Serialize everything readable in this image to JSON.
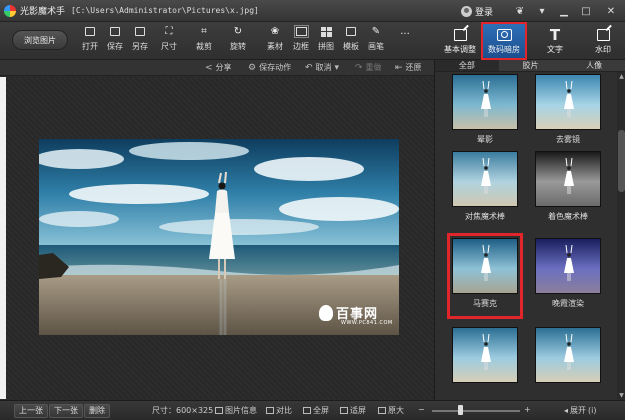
{
  "window": {
    "app_title": "光影魔术手",
    "file_path": "[C:\\Users\\Administrator\\Pictures\\x.jpg]",
    "login_label": "登录",
    "min_icon": "▁",
    "max_icon": "□",
    "close_icon": "✕",
    "skin_icon": "❦",
    "menu_icon": "▾"
  },
  "toolbar": {
    "browse_label": "浏览图片",
    "tools": [
      {
        "label": "打开",
        "icon": "open-icon"
      },
      {
        "label": "保存",
        "icon": "save-icon"
      },
      {
        "label": "另存",
        "icon": "save-as-icon"
      },
      {
        "label": "尺寸",
        "icon": "resize-icon"
      },
      {
        "label": "裁剪",
        "icon": "crop-icon"
      },
      {
        "label": "旋转",
        "icon": "rotate-icon"
      },
      {
        "label": "素材",
        "icon": "material-icon"
      },
      {
        "label": "边框",
        "icon": "border-icon"
      },
      {
        "label": "拼图",
        "icon": "collage-icon"
      },
      {
        "label": "模板",
        "icon": "template-icon"
      },
      {
        "label": "画笔",
        "icon": "brush-icon"
      }
    ],
    "more_label": "...",
    "big_tools": [
      {
        "label": "基本调整",
        "icon": "adjust-icon"
      },
      {
        "label": "数码暗房",
        "icon": "darkroom-icon",
        "active": true
      },
      {
        "label": "文字",
        "icon": "text-icon"
      },
      {
        "label": "水印",
        "icon": "watermark-icon"
      }
    ]
  },
  "actions": {
    "share": "分享",
    "save_action": "保存动作",
    "undo": "取消",
    "redo": "重做",
    "restore": "还原"
  },
  "panel": {
    "tabs": [
      "全部",
      "胶片",
      "人像"
    ],
    "effects": [
      "",
      "晕影",
      "去雾镜",
      "对焦魔术棒",
      "着色魔术棒",
      "马赛克",
      "晚霞渲染",
      "",
      ""
    ],
    "selected_index": 4
  },
  "watermark": {
    "text": "百事网",
    "sub": "WWW.PC841.COM"
  },
  "status": {
    "prev": "上一张",
    "next": "下一张",
    "delete": "删除",
    "size": "尺寸：600×325",
    "info": "图片信息",
    "compare": "对比",
    "fullscreen": "全屏",
    "fit": "适屏",
    "original": "原大",
    "expand": "展开",
    "expand_arrow": "(i)"
  },
  "colors": {
    "accent_red": "#e0262b",
    "active_blue": "#2e6fb6"
  }
}
